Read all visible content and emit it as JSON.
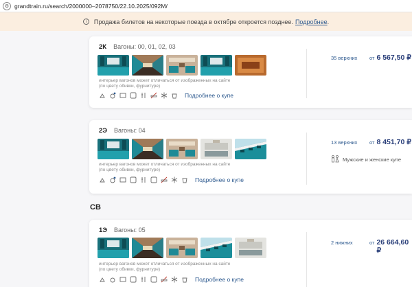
{
  "browser": {
    "url": "grandtrain.ru/search/2000000–2078750/22.10.2025/092M/"
  },
  "banner": {
    "text": "Продажа билетов на некоторые поезда в октябре откроется позднее.",
    "link": "Подробнее",
    "tail": "."
  },
  "cards": [
    {
      "car_class": "2К",
      "wagons": "Вагоны: 00, 01, 02, 03",
      "disclaimer": "интерьер вагонов может отличаться от изображенных на сайте (по цвету обивки, фурнитуре)",
      "more_link": "Подробнее о купе",
      "seats": "35 верхних",
      "price_from": "от",
      "price": "6 567,50 ₽"
    },
    {
      "car_class": "2Э",
      "wagons": "Вагоны: 04",
      "disclaimer": "интерьер вагонов может отличаться от изображенных на сайте (по цвету обивки, фурнитуре)",
      "more_link": "Подробнее о купе",
      "seats": "13 верхних",
      "price_from": "от",
      "price": "8 451,70 ₽",
      "gender": "Мужские и женские купе"
    },
    {
      "car_class": "1Э",
      "wagons": "Вагоны: 05",
      "disclaimer": "интерьер вагонов может отличаться от изображенных на сайте (по цвету обивки, фурнитуре)",
      "more_link": "Подробнее о купе",
      "seats": "2 нижних",
      "price_from": "от",
      "price": "26 664,60 ₽"
    }
  ],
  "section": {
    "sv": "СВ"
  },
  "colors": {
    "accent": "#2e5a8f",
    "price": "#2a3f7a",
    "banner_bg": "#fbeee0",
    "teal_upholstery": "#1f8a96"
  }
}
